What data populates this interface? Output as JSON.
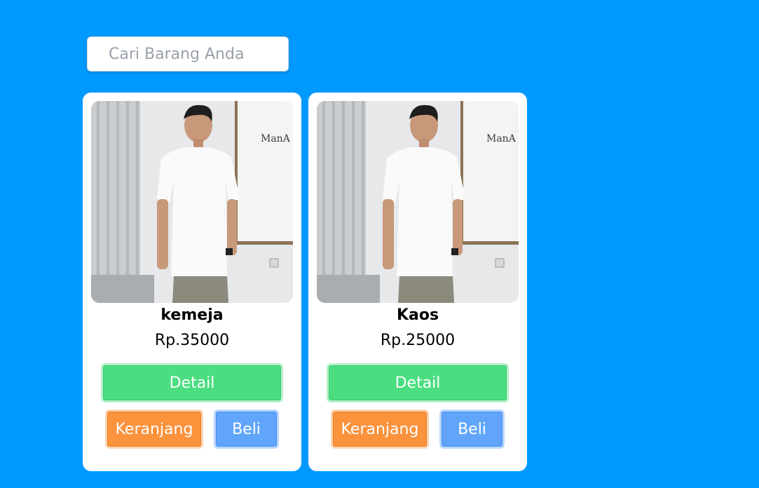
{
  "search": {
    "placeholder": "Cari Barang Anda"
  },
  "products": [
    {
      "name": "kemeja",
      "price": "Rp.35000",
      "detail_label": "Detail",
      "cart_label": "Keranjang",
      "buy_label": "Beli",
      "image_sign": "ManA"
    },
    {
      "name": "Kaos",
      "price": "Rp.25000",
      "detail_label": "Detail",
      "cart_label": "Keranjang",
      "buy_label": "Beli",
      "image_sign": "ManA"
    }
  ],
  "colors": {
    "background": "#0099ff",
    "detail_button": "#4ade80",
    "cart_button": "#fb923c",
    "buy_button": "#60a5fa"
  }
}
